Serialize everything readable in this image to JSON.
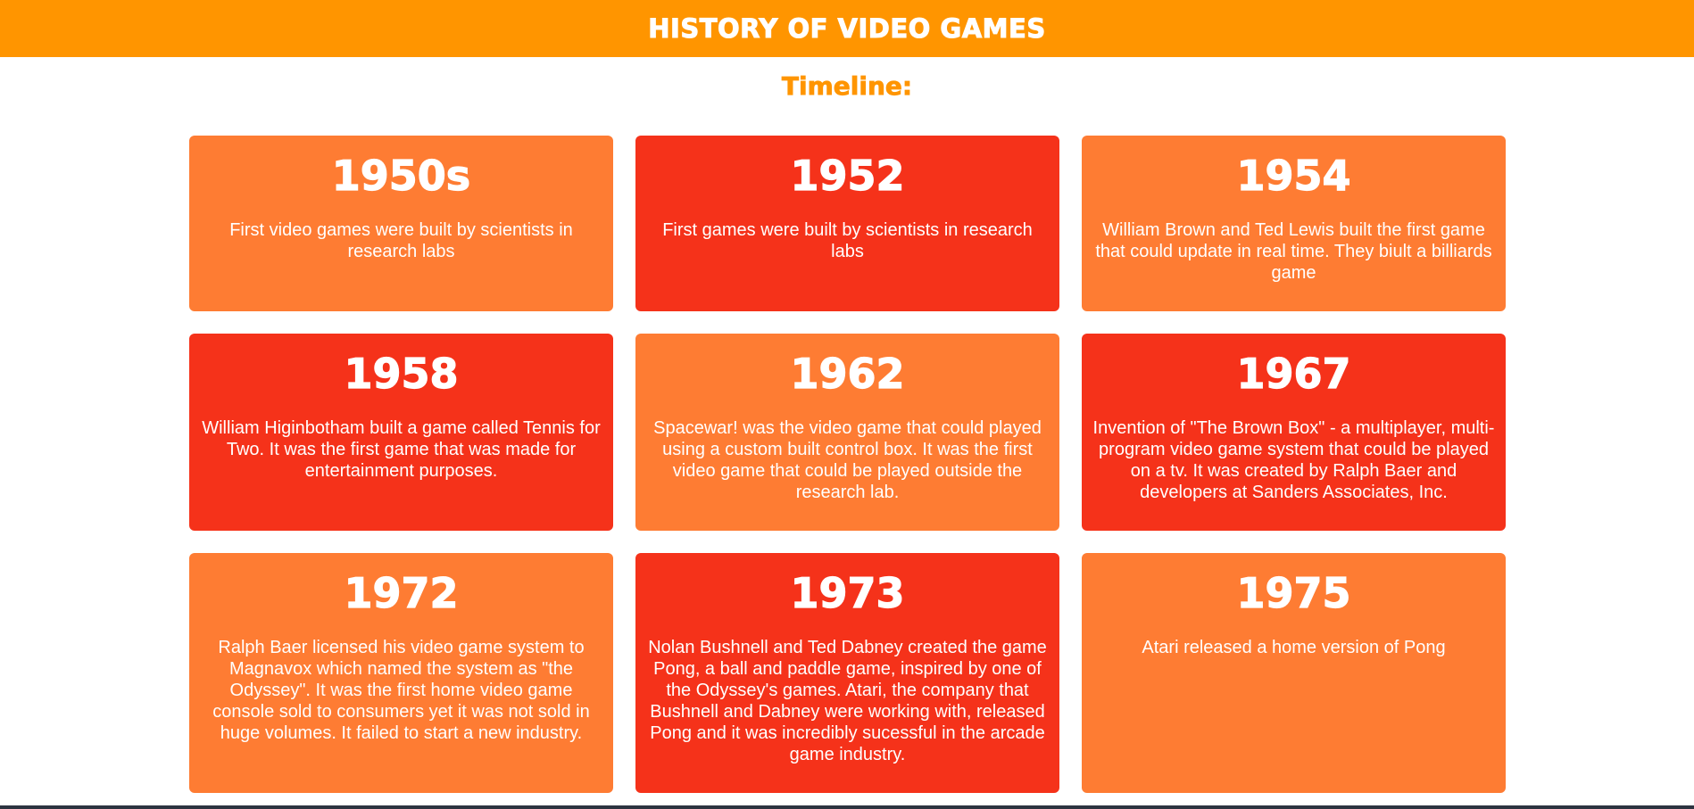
{
  "header": {
    "title": "History of Video Games"
  },
  "subtitle": "Timeline:",
  "timeline": [
    {
      "year": "1950s",
      "text": "First video games were built by scientists in research labs"
    },
    {
      "year": "1952",
      "text": "First games were built by scientists in research labs"
    },
    {
      "year": "1954",
      "text": "William Brown and Ted Lewis built the first game that could update in real time. They biult a billiards game"
    },
    {
      "year": "1958",
      "text": "William Higinbotham built a game called Tennis for Two. It was the first game that was made for entertainment purposes."
    },
    {
      "year": "1962",
      "text": "Spacewar! was the video game that could played using a custom built control box. It was the first video game that could be played outside the research lab."
    },
    {
      "year": "1967",
      "text": "Invention of \"The Brown Box\" - a multiplayer, multi-program video game system that could be played on a tv. It was created by Ralph Baer and developers at Sanders Associates, Inc."
    },
    {
      "year": "1972",
      "text": "Ralph Baer licensed his video game system to Magnavox which named the system as \"the Odyssey\". It was the first home video game console sold to consumers yet it was not sold in huge volumes. It failed to start a new industry."
    },
    {
      "year": "1973",
      "text": "Nolan Bushnell and Ted Dabney created the game Pong, a ball and paddle game, inspired by one of the Odyssey's games. Atari, the company that Bushnell and Dabney were working with, released Pong and it was incredibly sucessful in the arcade game industry."
    },
    {
      "year": "1975",
      "text": "Atari released a home version of Pong"
    }
  ],
  "colors": {
    "banner": "#ff9500",
    "card_light": "#fe7c33",
    "card_dark": "#f5321a"
  }
}
